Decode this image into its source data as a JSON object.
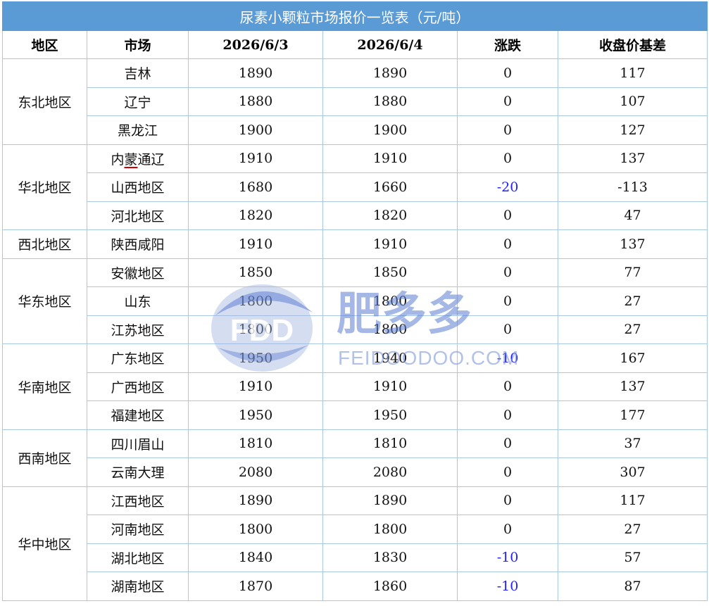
{
  "title": "尿素小颗粒市场报价一览表（元/吨）",
  "headers": [
    "地区",
    "市场",
    "2026/6/3",
    "2026/6/4",
    "涨跌",
    "收盘价基差"
  ],
  "groups": [
    {
      "region": "东北地区",
      "rows": [
        {
          "market": "吉林",
          "p1": "1890",
          "p2": "1890",
          "change": "0",
          "basis": "117"
        },
        {
          "market": "辽宁",
          "p1": "1880",
          "p2": "1880",
          "change": "0",
          "basis": "107"
        },
        {
          "market": "黑龙江",
          "p1": "1900",
          "p2": "1900",
          "change": "0",
          "basis": "127"
        }
      ]
    },
    {
      "region": "华北地区",
      "rows": [
        {
          "market": "内蒙通辽",
          "p1": "1910",
          "p2": "1910",
          "change": "0",
          "basis": "137"
        },
        {
          "market": "山西地区",
          "p1": "1680",
          "p2": "1660",
          "change": "-20",
          "basis": "-113"
        },
        {
          "market": "河北地区",
          "p1": "1820",
          "p2": "1820",
          "change": "0",
          "basis": "47"
        }
      ]
    },
    {
      "region": "西北地区",
      "rows": [
        {
          "market": "陕西咸阳",
          "p1": "1910",
          "p2": "1910",
          "change": "0",
          "basis": "137"
        }
      ]
    },
    {
      "region": "华东地区",
      "rows": [
        {
          "market": "安徽地区",
          "p1": "1850",
          "p2": "1850",
          "change": "0",
          "basis": "77"
        },
        {
          "market": "山东",
          "p1": "1800",
          "p2": "1800",
          "change": "0",
          "basis": "27"
        },
        {
          "market": "江苏地区",
          "p1": "1800",
          "p2": "1800",
          "change": "0",
          "basis": "27"
        }
      ]
    },
    {
      "region": "华南地区",
      "rows": [
        {
          "market": "广东地区",
          "p1": "1950",
          "p2": "1940",
          "change": "-10",
          "basis": "167"
        },
        {
          "market": "广西地区",
          "p1": "1910",
          "p2": "1910",
          "change": "0",
          "basis": "137"
        },
        {
          "market": "福建地区",
          "p1": "1950",
          "p2": "1950",
          "change": "0",
          "basis": "177"
        }
      ]
    },
    {
      "region": "西南地区",
      "rows": [
        {
          "market": "四川眉山",
          "p1": "1810",
          "p2": "1810",
          "change": "0",
          "basis": "37"
        },
        {
          "market": "云南大理",
          "p1": "2080",
          "p2": "2080",
          "change": "0",
          "basis": "307"
        }
      ]
    },
    {
      "region": "华中地区",
      "rows": [
        {
          "market": "江西地区",
          "p1": "1890",
          "p2": "1890",
          "change": "0",
          "basis": "117"
        },
        {
          "market": "河南地区",
          "p1": "1800",
          "p2": "1800",
          "change": "0",
          "basis": "27"
        },
        {
          "market": "湖北地区",
          "p1": "1840",
          "p2": "1830",
          "change": "-10",
          "basis": "57"
        },
        {
          "market": "湖南地区",
          "p1": "1870",
          "p2": "1860",
          "change": "-10",
          "basis": "87"
        }
      ]
    }
  ],
  "watermark": {
    "logo_text": "FDD",
    "brand": "肥多多",
    "url": "FEIDOODOO.COM"
  },
  "colors": {
    "header_bg": "#5b9bd5",
    "border": "#a9c7e6",
    "negative": "#1f1fff",
    "underline": "#d00000"
  }
}
